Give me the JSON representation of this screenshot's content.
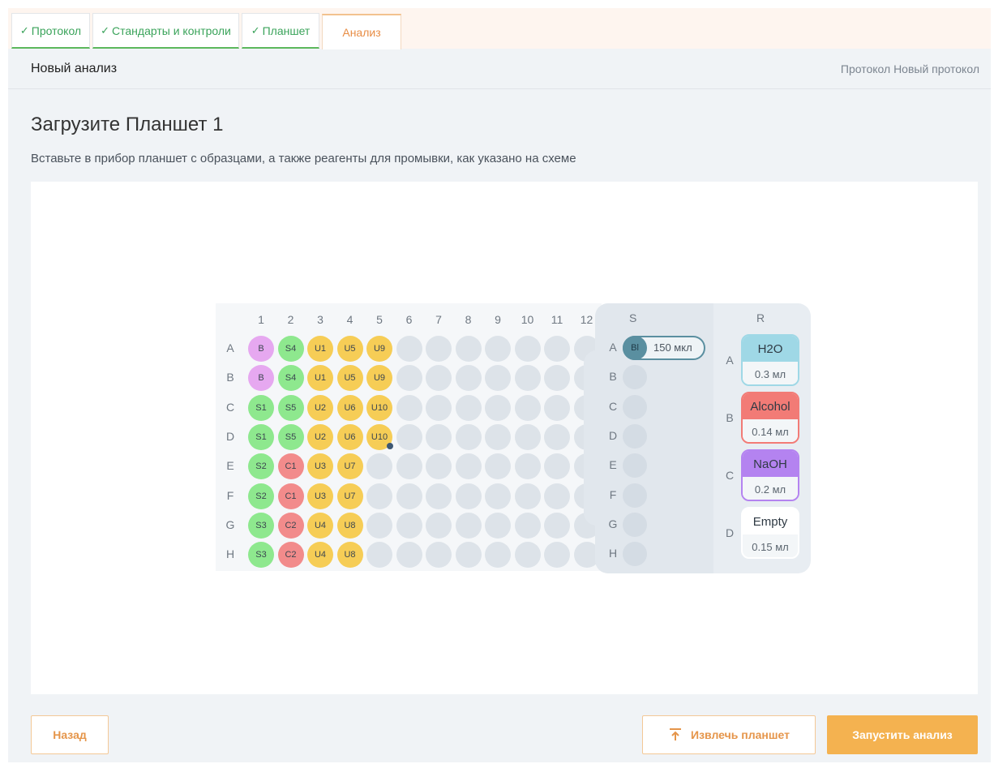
{
  "tabs": [
    {
      "label": "Протокол",
      "done": true
    },
    {
      "label": "Стандарты и контроли",
      "done": true
    },
    {
      "label": "Планшет",
      "done": true
    },
    {
      "label": "Анализ",
      "done": false
    }
  ],
  "header": {
    "title": "Новый анализ",
    "protocol": "Протокол Новый протокол"
  },
  "page": {
    "title": "Загрузите Планшет 1",
    "instructions": "Вставьте в прибор планшет с образцами, а также реагенты для промывки, как указано на схеме"
  },
  "plate": {
    "columns": [
      "1",
      "2",
      "3",
      "4",
      "5",
      "6",
      "7",
      "8",
      "9",
      "10",
      "11",
      "12"
    ],
    "rows": [
      "A",
      "B",
      "C",
      "D",
      "E",
      "F",
      "G",
      "H"
    ],
    "wells": [
      [
        "B",
        "S4",
        "U1",
        "U5",
        "U9",
        "",
        "",
        "",
        "",
        "",
        "",
        ""
      ],
      [
        "B",
        "S4",
        "U1",
        "U5",
        "U9",
        "",
        "",
        "",
        "",
        "",
        "",
        ""
      ],
      [
        "S1",
        "S5",
        "U2",
        "U6",
        "U10",
        "",
        "",
        "",
        "",
        "",
        "",
        ""
      ],
      [
        "S1",
        "S5",
        "U2",
        "U6",
        "U10",
        "",
        "",
        "",
        "",
        "",
        "",
        ""
      ],
      [
        "S2",
        "C1",
        "U3",
        "U7",
        "",
        "",
        "",
        "",
        "",
        "",
        "",
        ""
      ],
      [
        "S2",
        "C1",
        "U3",
        "U7",
        "",
        "",
        "",
        "",
        "",
        "",
        "",
        ""
      ],
      [
        "S3",
        "C2",
        "U4",
        "U8",
        "",
        "",
        "",
        "",
        "",
        "",
        "",
        ""
      ],
      [
        "S3",
        "C2",
        "U4",
        "U8",
        "",
        "",
        "",
        "",
        "",
        "",
        "",
        ""
      ]
    ],
    "marker_well": "D5"
  },
  "rack": {
    "s_header": "S",
    "r_header": "R",
    "s_rows": [
      "A",
      "B",
      "C",
      "D",
      "E",
      "F",
      "G",
      "H"
    ],
    "s_filled": {
      "cap": "Bl",
      "volume": "150 мкл"
    },
    "r_rows": [
      "A",
      "B",
      "C",
      "D"
    ],
    "reagents": [
      {
        "name": "H2O",
        "volume": "0.3 мл",
        "color": "#9fd8e6"
      },
      {
        "name": "Alcohol",
        "volume": "0.14 мл",
        "color": "#f27b76"
      },
      {
        "name": "NaOH",
        "volume": "0.2 мл",
        "color": "#b483f0"
      },
      {
        "name": "Empty",
        "volume": "0.15 мл",
        "color": "#ffffff"
      }
    ]
  },
  "buttons": {
    "back": "Назад",
    "eject": "Извлечь планшет",
    "start": "Запустить анализ"
  },
  "colors": {
    "accent": "#f4b250",
    "done": "#3aa35a"
  }
}
